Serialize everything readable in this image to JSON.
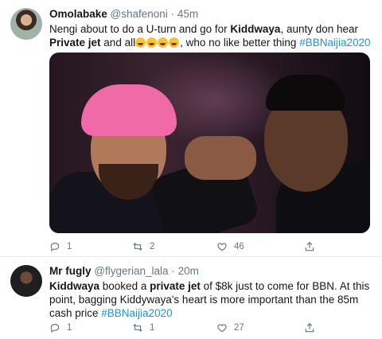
{
  "tweets": [
    {
      "name": "Omolabake",
      "handle": "@shafenoni",
      "sep": "·",
      "time": "45m",
      "text1": "Nengi about to do a U-turn and go for ",
      "bold1": "Kiddwaya",
      "text2": ", aunty don hear ",
      "bold2": "Private jet",
      "text3": " and all",
      "emoji_count": 4,
      "text4": ", who no like better thing ",
      "hashtag": "#BBNaijia2020",
      "replies": "1",
      "retweets": "2",
      "likes": "46"
    },
    {
      "name": "Mr fugly",
      "handle": "@flygerian_lala",
      "sep": "·",
      "time": "20m",
      "bold1": "Kiddwaya",
      "text1": " booked a ",
      "bold2": "private jet",
      "text2": " of $8k just to come for BBN. At this point, bagging Kiddywaya's heart is more important than the 85m cash price ",
      "hashtag": "#BBNaijia2020",
      "replies": "1",
      "retweets": "1",
      "likes": "27"
    }
  ],
  "icons": [
    "reply-icon",
    "retweet-icon",
    "like-icon",
    "share-icon"
  ],
  "colors": {
    "hashtag": "#1b95e0",
    "meta": "#657786",
    "divider": "#e6ecf0",
    "hair": "#f06aa8"
  }
}
